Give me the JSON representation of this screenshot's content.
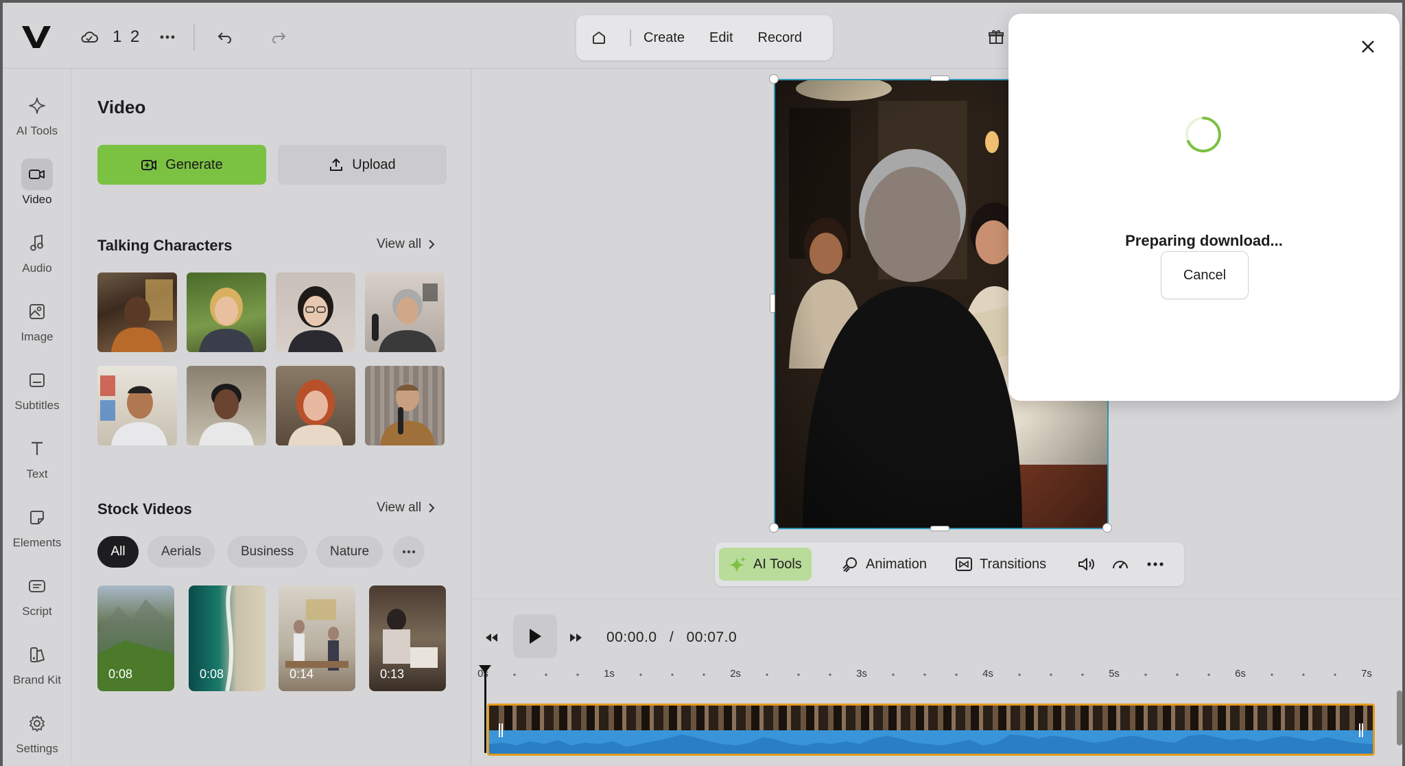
{
  "topbar": {
    "logo": "V",
    "cloud_icon": "cloud-icon",
    "project_number": "1 2",
    "more_icon": "more-horizontal-icon",
    "undo_icon": "undo-icon",
    "redo_icon": "redo-icon",
    "modes": [
      "Create",
      "Edit",
      "Record"
    ],
    "home_icon": "home-icon",
    "gift_icon": "gift-icon"
  },
  "rail": {
    "items": [
      {
        "label": "AI Tools",
        "icon": "sparkle-icon"
      },
      {
        "label": "Video",
        "icon": "video-camera-icon"
      },
      {
        "label": "Audio",
        "icon": "music-note-icon"
      },
      {
        "label": "Image",
        "icon": "image-icon"
      },
      {
        "label": "Subtitles",
        "icon": "subtitles-icon"
      },
      {
        "label": "Text",
        "icon": "text-icon"
      },
      {
        "label": "Elements",
        "icon": "elements-icon"
      },
      {
        "label": "Script",
        "icon": "script-icon"
      },
      {
        "label": "Brand Kit",
        "icon": "brand-kit-icon"
      },
      {
        "label": "Settings",
        "icon": "gear-icon"
      }
    ],
    "active": "Video"
  },
  "panel": {
    "title": "Video",
    "generate_label": "Generate",
    "upload_label": "Upload",
    "talking": {
      "title": "Talking Characters",
      "view_all": "View all"
    },
    "stock": {
      "title": "Stock Videos",
      "view_all": "View all",
      "chips": [
        "All",
        "Aerials",
        "Business",
        "Nature"
      ],
      "active_chip": "All",
      "videos": [
        {
          "duration": "0:08"
        },
        {
          "duration": "0:08"
        },
        {
          "duration": "0:14"
        },
        {
          "duration": "0:13"
        }
      ]
    }
  },
  "edit_tools": {
    "ai_tools": "AI Tools",
    "animation": "Animation",
    "transitions": "Transitions",
    "volume_icon": "volume-icon",
    "speed_icon": "speedometer-icon",
    "more_icon": "more-horizontal-icon"
  },
  "playback": {
    "current": "00:00.0",
    "separator": "/",
    "total": "00:07.0",
    "ticks": [
      "0s",
      "1s",
      "2s",
      "3s",
      "4s",
      "5s",
      "6s",
      "7s"
    ]
  },
  "modal": {
    "message": "Preparing download...",
    "cancel_label": "Cancel",
    "close_icon": "close-icon",
    "accent": "#7bc142"
  }
}
